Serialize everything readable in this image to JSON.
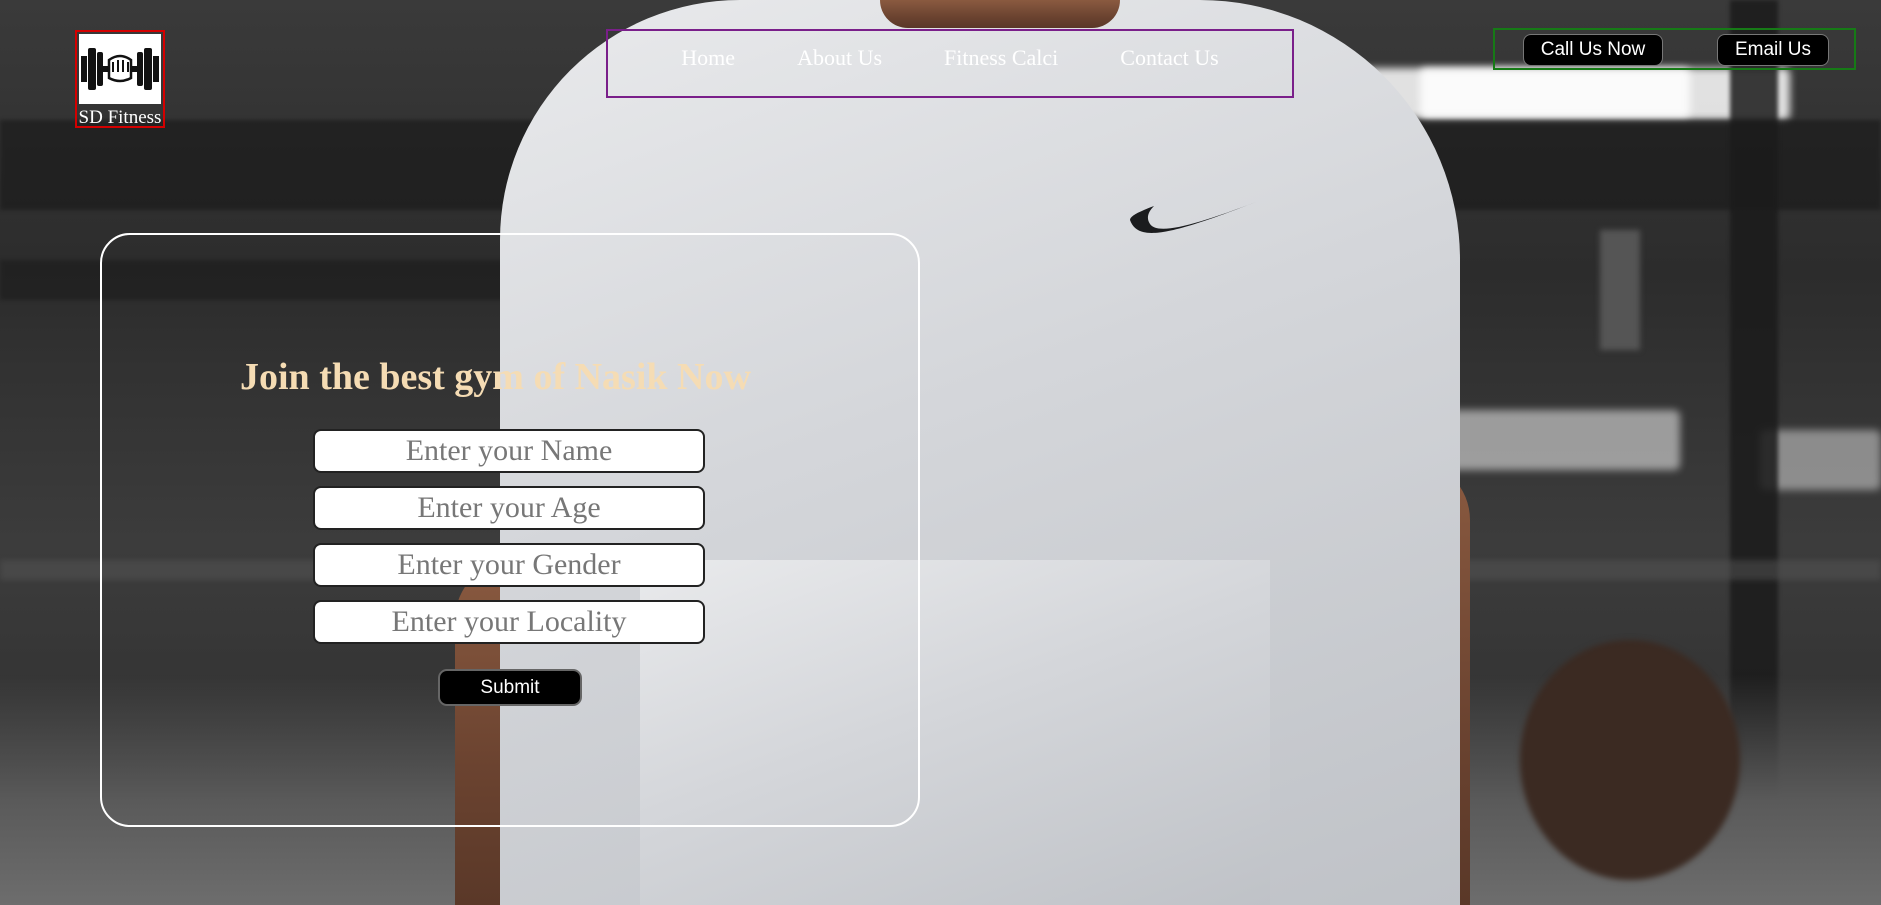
{
  "brand": {
    "name": "SD Fitness",
    "logo_icon": "dumbbell-fist-icon"
  },
  "nav": {
    "items": [
      {
        "label": "Home"
      },
      {
        "label": "About Us"
      },
      {
        "label": "Fitness Calci"
      },
      {
        "label": "Contact Us"
      }
    ]
  },
  "contact": {
    "call_label": "Call Us Now",
    "email_label": "Email Us"
  },
  "form": {
    "heading": "Join the best gym of Nasik Now",
    "name_placeholder": "Enter your Name",
    "age_placeholder": "Enter your Age",
    "gender_placeholder": "Enter your Gender",
    "locality_placeholder": "Enter your Locality",
    "submit_label": "Submit"
  },
  "colors": {
    "heading": "#f5dcb4",
    "logo_border": "#d40000",
    "nav_border": "#7a1f8a",
    "contact_border": "#167a16",
    "button_bg": "#000000"
  }
}
